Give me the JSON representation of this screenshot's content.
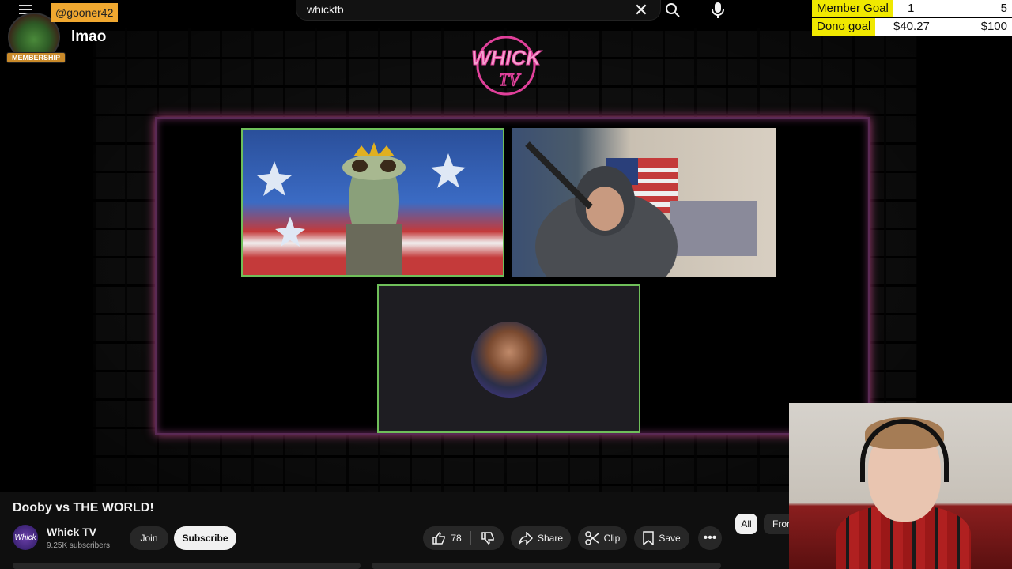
{
  "chat": {
    "username": "@gooner42",
    "message": "lmao",
    "badge": "MEMBERSHIP"
  },
  "search": {
    "query": "whicktb"
  },
  "goals": [
    {
      "label": "Member Goal",
      "current": "1",
      "max": "5"
    },
    {
      "label": "Dono goal",
      "current": "$40.27",
      "max": "$100"
    }
  ],
  "video": {
    "title": "Dooby vs THE WORLD!"
  },
  "channel": {
    "name": "Whick TV",
    "subscribers": "9.25K subscribers",
    "avatar_text": "Whick"
  },
  "actions": {
    "join": "Join",
    "subscribe": "Subscribe",
    "like_count": "78",
    "share": "Share",
    "clip": "Clip",
    "save": "Save"
  },
  "chips": {
    "all": "All",
    "from": "Fror"
  },
  "colors": {
    "goal_label_bg": "#f0e800",
    "chat_user_bg": "#f0a830",
    "feed_border": "#6fbf5a",
    "neon": "#e0409a"
  },
  "icons": [
    "menu-icon",
    "close-icon",
    "search-icon",
    "mic-icon",
    "thumbs-up-icon",
    "thumbs-down-icon",
    "share-icon",
    "scissors-icon",
    "bookmark-icon",
    "more-icon"
  ]
}
